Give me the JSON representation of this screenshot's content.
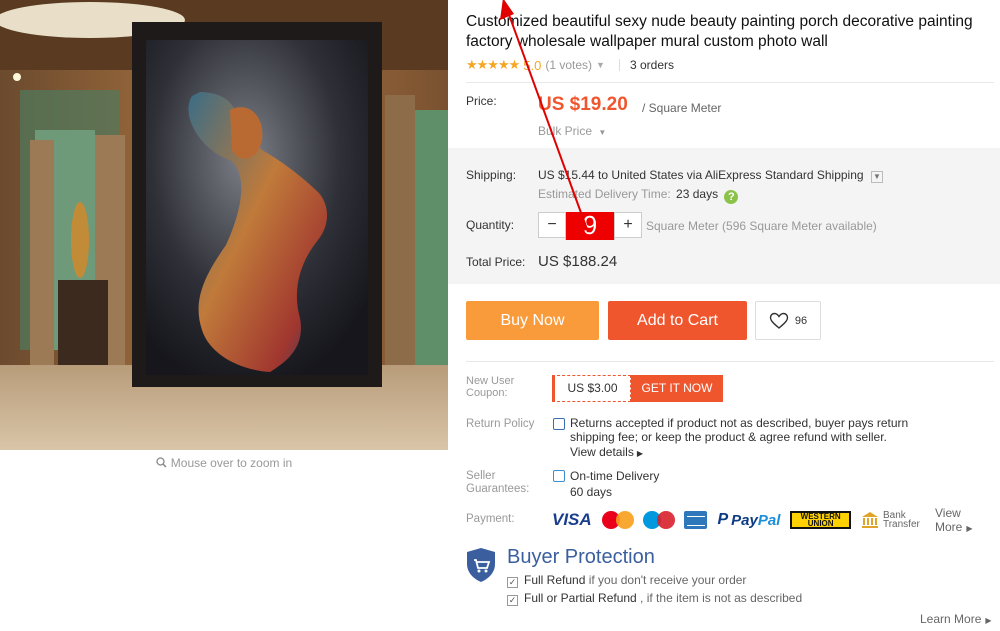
{
  "product": {
    "title": "Customized beautiful sexy nude beauty painting porch decorative painting factory wholesale wallpaper mural custom photo wall",
    "stars": "★★★★★",
    "rating": "5.0",
    "votes": "(1 votes)",
    "orders": "3 orders"
  },
  "gallery": {
    "zoom_hint": "Mouse over to zoom in"
  },
  "price": {
    "label": "Price:",
    "value": "US $19.20",
    "unit": "/ Square Meter",
    "bulk": "Bulk Price"
  },
  "shipping": {
    "label": "Shipping:",
    "cost": "US $15.44",
    "to_word": " to ",
    "destination": "United States",
    "via_word": " via ",
    "method": "AliExpress Standard Shipping",
    "eta_label": "Estimated Delivery Time:",
    "eta_value": "23 days"
  },
  "quantity": {
    "label": "Quantity:",
    "minus": "−",
    "value": "9",
    "plus": "+",
    "available": "Square Meter (596 Square Meter available)"
  },
  "total": {
    "label": "Total Price:",
    "value": "US $188.24"
  },
  "actions": {
    "buy_now": "Buy Now",
    "add_to_cart": "Add to Cart",
    "wishlist_count": "96"
  },
  "coupon": {
    "label": "New User Coupon:",
    "amount": "US $3.00",
    "cta": "GET IT NOW"
  },
  "return_policy": {
    "label": "Return Policy",
    "text": "Returns accepted if product not as described, buyer pays return shipping fee; or keep the product & agree refund with seller.",
    "link": "View details"
  },
  "seller_guarantees": {
    "label": "Seller Guarantees:",
    "line1": "On-time Delivery",
    "line2": "60 days"
  },
  "payment": {
    "label": "Payment:",
    "visa": "VISA",
    "paypal_pay": "Pay",
    "paypal_pal": "Pal",
    "wu": "WESTERN UNION",
    "bank": "Bank Transfer",
    "view_more": "View More"
  },
  "buyer_protection": {
    "title": "Buyer Protection",
    "item1_strong": "Full Refund",
    "item1_rest": " if you don't receive your order",
    "item2_strong": "Full or Partial Refund",
    "item2_rest": " , if the item is not as described",
    "learn_more": "Learn More"
  },
  "colors": {
    "accent": "#f0562e",
    "buy_now": "#f99b3b",
    "protection_blue": "#3b5f9e",
    "annotation_red": "#e00000"
  }
}
